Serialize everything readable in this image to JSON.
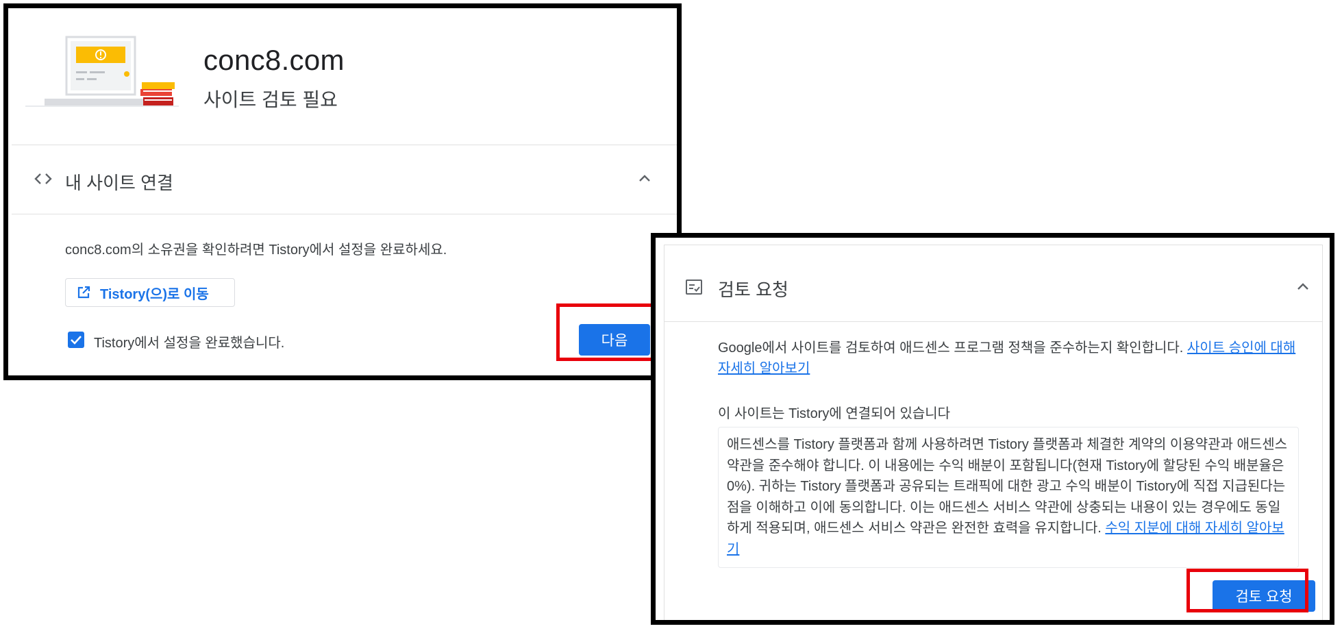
{
  "panel1": {
    "site_domain": "conc8.com",
    "site_status": "사이트 검토 필요",
    "section_title": "내 사이트 연결",
    "instruction": "conc8.com의 소유권을 확인하려면 Tistory에서 설정을 완료하세요.",
    "tistory_button": "Tistory(으)로 이동",
    "checkbox_label": "Tistory에서 설정을 완료했습니다.",
    "checkbox_checked": true,
    "next_button": "다음"
  },
  "panel2": {
    "section_title": "검토 요청",
    "description": "Google에서 사이트를 검토하여 애드센스 프로그램 정책을 준수하는지 확인합니다. ",
    "description_link": "사이트 승인에 대해 자세히 알아보기",
    "connected_label": "이 사이트는 Tistory에 연결되어 있습니다",
    "terms_text": "애드센스를 Tistory 플랫폼과 함께 사용하려면 Tistory 플랫폼과 체결한 계약의 이용약관과 애드센스 약관을 준수해야 합니다. 이 내용에는 수익 배분이 포함됩니다(현재 Tistory에 할당된 수익 배분율은 0%). 귀하는 Tistory 플랫폼과 공유되는 트래픽에 대한 광고 수익 배분이 Tistory에 직접 지급된다는 점을 이해하고 이에 동의합니다. 이는 애드센스 서비스 약관에 상충되는 내용이 있는 경우에도 동일하게 적용되며, 애드센스 서비스 약관은 완전한 효력을 유지합니다. ",
    "terms_link": "수익 지분에 대해 자세히 알아보기",
    "review_button": "검토 요청"
  },
  "colors": {
    "accent": "#1a73e8",
    "highlight_box": "#e8000b",
    "warning_yellow": "#fbbc04"
  },
  "icons": [
    "code-icon",
    "chevron-up-icon",
    "open-in-new-icon",
    "checkbox-checked-icon",
    "review-request-icon",
    "warning-icon"
  ]
}
